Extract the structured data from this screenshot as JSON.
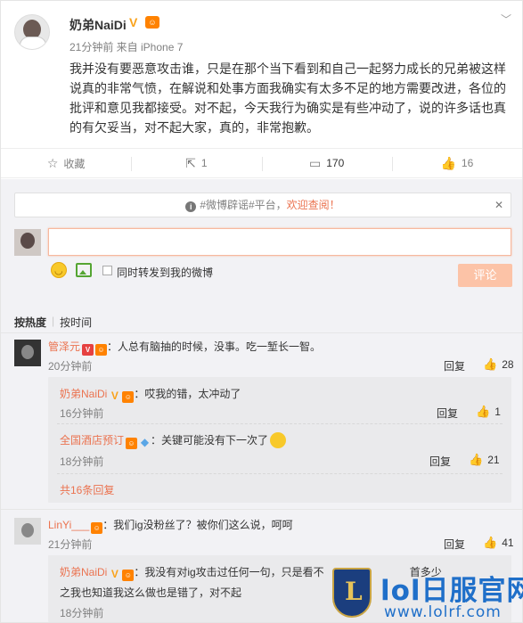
{
  "post": {
    "author": "奶弟NaiDi",
    "verified_icon": "v-badge",
    "level_icon": "level-badge",
    "meta": "21分钟前 来自 iPhone 7",
    "text": "我并没有要恶意攻击谁，只是在那个当下看到和自己一起努力成长的兄弟被这样说真的非常气愤，在解说和处事方面我确实有太多不足的地方需要改进，各位的批评和意见我都接受。对不起，今天我行为确实是有些冲动了，说的许多话也真的有欠妥当，对不起大家，真的，非常抱歉。"
  },
  "actions": {
    "favorite_label": "收藏",
    "forward_count": "1",
    "comment_count": "170",
    "like_count": "16"
  },
  "composer": {
    "notice_prefix": "#微博辟谣#平台，",
    "notice_link": "欢迎查阅！",
    "forward_label": "同时转发到我的微博",
    "submit_label": "评论"
  },
  "sort": {
    "hot": "按热度",
    "time": "按时间"
  },
  "comments": [
    {
      "name": "管泽元",
      "text": "：人总有脑抽的时候，没事。吃一堑长一智。",
      "time": "20分钟前",
      "reply_label": "回复",
      "likes": "28",
      "replies": [
        {
          "name": "奶弟NaiDi",
          "text": "：哎我的错，太冲动了",
          "time": "16分钟前",
          "reply_label": "回复",
          "likes": "1"
        },
        {
          "name": "全国酒店预订",
          "text": "：关键可能没有下一次了",
          "time": "18分钟前",
          "reply_label": "回复",
          "likes": "21"
        }
      ],
      "more_label": "共16条回复"
    },
    {
      "name": "LinYi___",
      "text": "：我们ig没粉丝了？被你们这么说，呵呵",
      "time": "21分钟前",
      "reply_label": "回复",
      "likes": "41",
      "replies": [
        {
          "name": "奶弟NaiDi",
          "text_line1": "：我没有对ig攻击过任何一句，只是看不",
          "text_line1_tail": "首多少",
          "text_line2": "之我也知道我这么做也是错了，对不起",
          "time": "18分钟前"
        }
      ]
    }
  ],
  "watermark": {
    "title": "lol日服官网",
    "url": "www.lolrf.com"
  }
}
